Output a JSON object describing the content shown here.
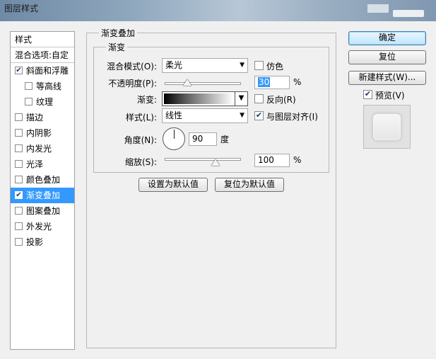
{
  "window": {
    "title": "图层样式"
  },
  "styles_panel": {
    "header": "样式",
    "blend_options": "混合选项:自定",
    "items": [
      {
        "label": "斜面和浮雕",
        "checked": true,
        "indent": false,
        "selected": false
      },
      {
        "label": "等高线",
        "checked": false,
        "indent": true,
        "selected": false
      },
      {
        "label": "纹理",
        "checked": false,
        "indent": true,
        "selected": false
      },
      {
        "label": "描边",
        "checked": false,
        "indent": false,
        "selected": false
      },
      {
        "label": "内阴影",
        "checked": false,
        "indent": false,
        "selected": false
      },
      {
        "label": "内发光",
        "checked": false,
        "indent": false,
        "selected": false
      },
      {
        "label": "光泽",
        "checked": false,
        "indent": false,
        "selected": false
      },
      {
        "label": "颜色叠加",
        "checked": false,
        "indent": false,
        "selected": false
      },
      {
        "label": "渐变叠加",
        "checked": true,
        "indent": false,
        "selected": true
      },
      {
        "label": "图案叠加",
        "checked": false,
        "indent": false,
        "selected": false
      },
      {
        "label": "外发光",
        "checked": false,
        "indent": false,
        "selected": false
      },
      {
        "label": "投影",
        "checked": false,
        "indent": false,
        "selected": false
      }
    ]
  },
  "gradient_overlay": {
    "section_title": "渐变叠加",
    "subsection_title": "渐变",
    "blend_mode": {
      "label": "混合模式(O):",
      "value": "柔光"
    },
    "dither": {
      "label": "仿色",
      "checked": false
    },
    "opacity": {
      "label": "不透明度(P):",
      "value": "30",
      "unit": "%",
      "level": 0.3
    },
    "gradient": {
      "label": "渐变:",
      "colors": [
        "#000000",
        "#ffffff"
      ]
    },
    "reverse": {
      "label": "反向(R)",
      "checked": false
    },
    "style": {
      "label": "样式(L):",
      "value": "线性"
    },
    "align_with_layer": {
      "label": "与图层对齐(I)",
      "checked": true
    },
    "angle": {
      "label": "角度(N):",
      "value": "90",
      "unit": "度"
    },
    "scale": {
      "label": "缩放(S):",
      "value": "100",
      "unit": "%",
      "level": 0.67
    },
    "make_default": "设置为默认值",
    "reset_default": "复位为默认值"
  },
  "actions": {
    "ok": "确定",
    "reset": "复位",
    "new_style": "新建样式(W)...",
    "preview": {
      "label": "预览(V)",
      "checked": true
    }
  },
  "colors": {
    "selection": "#3399ff",
    "dialog_bg": "#f0f0f0"
  }
}
